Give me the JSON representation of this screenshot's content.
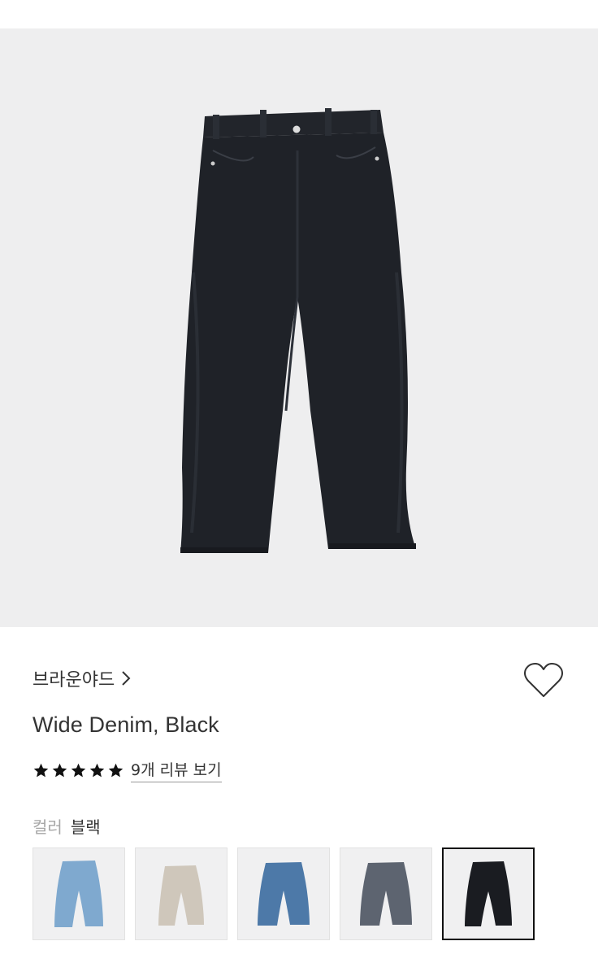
{
  "product": {
    "brand": "브라운야드",
    "name": "Wide Denim, Black",
    "rating_stars": 5,
    "review_link": "9개 리뷰 보기"
  },
  "color": {
    "label": "컬러",
    "selected": "블랙"
  },
  "swatches": [
    {
      "id": "light-blue",
      "fill": "#7fa9cf",
      "selected": false
    },
    {
      "id": "beige",
      "fill": "#cfc7bb",
      "selected": false
    },
    {
      "id": "mid-blue",
      "fill": "#4d79a8",
      "selected": false
    },
    {
      "id": "gray",
      "fill": "#5d6470",
      "selected": false
    },
    {
      "id": "black",
      "fill": "#1a1c21",
      "selected": true
    }
  ],
  "colors": {
    "image_bg": "#eeeeef",
    "jeans_main": "#1f2228",
    "text": "#333333",
    "muted": "#a6a6a6"
  },
  "icons": [
    "chevron-right-icon",
    "heart-outline-icon",
    "star-filled-icon"
  ]
}
